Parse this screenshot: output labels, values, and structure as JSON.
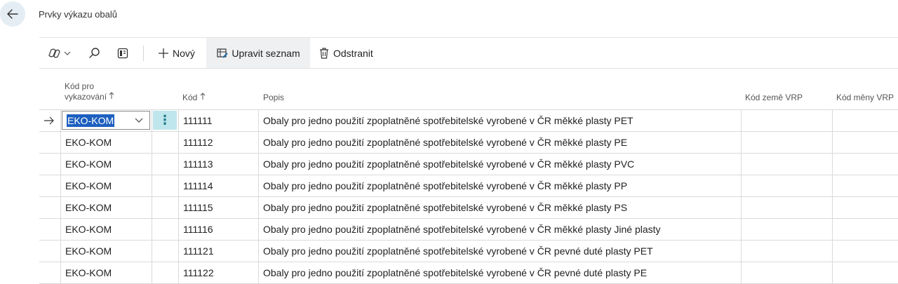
{
  "page": {
    "title": "Prvky výkazu obalů"
  },
  "toolbar": {
    "new_label": "Nový",
    "edit_list_label": "Upravit seznam",
    "delete_label": "Odstranit"
  },
  "columns": {
    "report_code_line1": "Kód pro",
    "report_code_line2": "vykazování",
    "code": "Kód",
    "description": "Popis",
    "country_code": "Kód země VRP",
    "currency_code": "Kód měny VRP"
  },
  "rows": [
    {
      "report_code": "EKO-KOM",
      "code": "111111",
      "description": "Obaly pro jedno použití zpoplatněné spotřebitelské vyrobené v ČR měkké plasty PET"
    },
    {
      "report_code": "EKO-KOM",
      "code": "111112",
      "description": "Obaly pro jedno použití zpoplatněné spotřebitelské vyrobené v ČR měkké plasty PE"
    },
    {
      "report_code": "EKO-KOM",
      "code": "111113",
      "description": "Obaly pro jedno použití zpoplatněné spotřebitelské vyrobené v ČR měkké plasty PVC"
    },
    {
      "report_code": "EKO-KOM",
      "code": "111114",
      "description": "Obaly pro jedno použití zpoplatněné spotřebitelské vyrobené v ČR měkké plasty PP"
    },
    {
      "report_code": "EKO-KOM",
      "code": "111115",
      "description": "Obaly pro jedno použití zpoplatněné spotřebitelské vyrobené v ČR měkké plasty PS"
    },
    {
      "report_code": "EKO-KOM",
      "code": "111116",
      "description": "Obaly pro jedno použití zpoplatněné spotřebitelské vyrobené v ČR měkké plasty Jiné plasty"
    },
    {
      "report_code": "EKO-KOM",
      "code": "111121",
      "description": "Obaly pro jedno použití zpoplatněné spotřebitelské vyrobené v ČR pevné duté plasty PET"
    },
    {
      "report_code": "EKO-KOM",
      "code": "111122",
      "description": "Obaly pro jedno použití zpoplatněné spotřebitelské vyrobené v ČR pevné duté plasty PE"
    }
  ],
  "icons": {
    "back": "back-arrow-icon",
    "copilot": "copilot-icon",
    "search": "search-icon",
    "filter_pane": "filter-pane-icon",
    "new": "plus-icon",
    "edit_list": "edit-list-icon",
    "delete": "trash-icon",
    "row_marker": "row-arrow-icon",
    "dropdown": "chevron-down-icon",
    "more": "more-options-icon"
  },
  "colors": {
    "selection": "#1d5fbf",
    "more_button_bg": "#bfe6ec",
    "back_button_bg": "#e4edf4"
  }
}
